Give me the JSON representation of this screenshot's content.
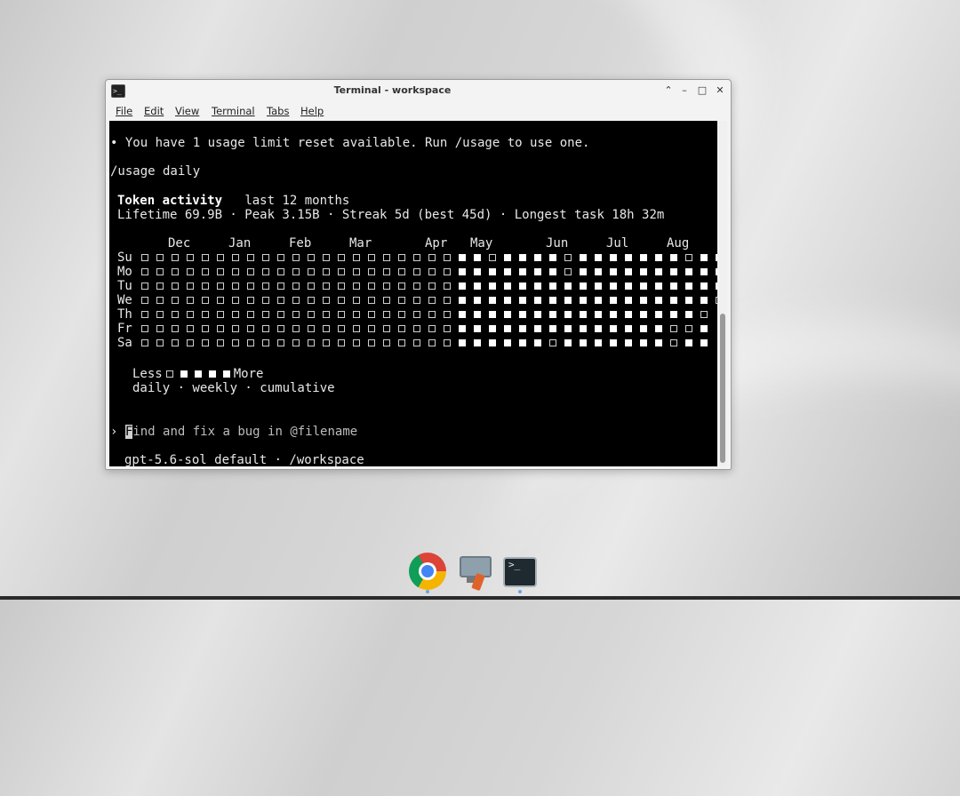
{
  "window": {
    "title": "Terminal - workspace",
    "menus": [
      "File",
      "Edit",
      "View",
      "Terminal",
      "Tabs",
      "Help"
    ],
    "controls": {
      "up": "⌃",
      "minimize": "–",
      "maximize": "□",
      "close": "✕"
    }
  },
  "terminal": {
    "notice": "• You have 1 usage limit reset available. Run /usage to use one.",
    "command": "/usage daily",
    "heading": "Token activity",
    "heading_sub": "last 12 months",
    "stats": "Lifetime 69.9B · Peak 3.15B · Streak 5d (best 45d) · Longest task 18h 32m",
    "months": [
      "Dec",
      "Jan",
      "Feb",
      "Mar",
      "Apr",
      "May",
      "Jun",
      "Jul",
      "Aug"
    ],
    "days": [
      "Su",
      "Mo",
      "Tu",
      "We",
      "Th",
      "Fr",
      "Sa"
    ],
    "grid": [
      "000000000000000000000110111101111111011",
      "000000000000000000000111111101111111111",
      "000000000000000000000111111111111111111",
      "000000000000000000000111111111111111110",
      "00000000000000000000011111111111111110",
      "00000000000000000000011111111111111001",
      "00000000000000000000011111101111111011"
    ],
    "legend_less": "Less",
    "legend_more": "More",
    "views": "daily · weekly · cumulative",
    "prompt_symbol": "›",
    "prompt_cursor_char": "F",
    "prompt_placeholder": "ind and fix a bug in @filename",
    "status": "gpt-5.6-sol default · /workspace"
  },
  "dock": {
    "items": [
      "chrome-icon",
      "package-manager-icon",
      "terminal-icon"
    ],
    "terminal_glyph": ">_"
  }
}
